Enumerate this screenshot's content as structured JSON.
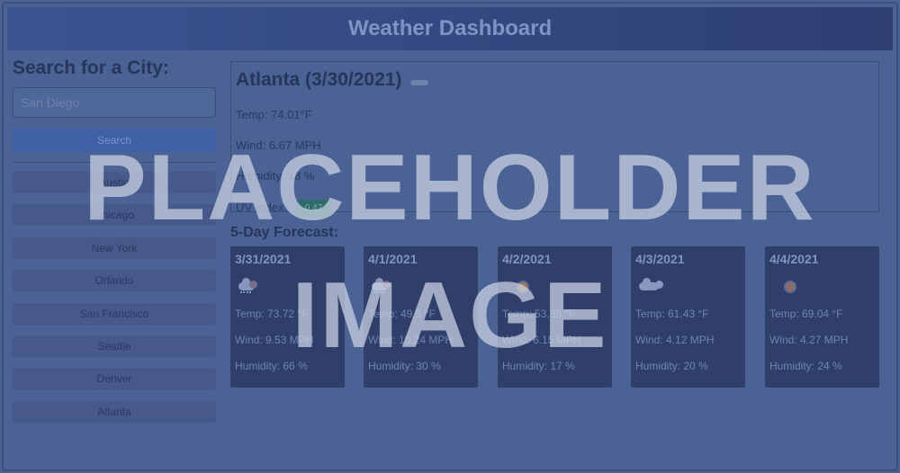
{
  "header": {
    "title": "Weather Dashboard"
  },
  "sidebar": {
    "heading": "Search for a City:",
    "search_value": "San Diego",
    "search_button": "Search",
    "cities": [
      "Austin",
      "Chicago",
      "New York",
      "Orlando",
      "San Francisco",
      "Seattle",
      "Denver",
      "Atlanta"
    ]
  },
  "current": {
    "title": "Atlanta (3/30/2021)",
    "temp": "Temp: 74.01°F",
    "wind": "Wind: 6.67 MPH",
    "humidity": "Humidity: 18 %",
    "uv_label": "UV Index:",
    "uv_value": "0.47",
    "icon": "cloud-icon"
  },
  "forecast": {
    "title": "5-Day Forecast:",
    "days": [
      {
        "date": "3/31/2021",
        "icon": "cloud-rain-icon",
        "temp": "Temp: 73.72 °F",
        "wind": "Wind: 9.53 MPH",
        "humidity": "Humidity: 66 %"
      },
      {
        "date": "4/1/2021",
        "icon": "cloud-rain-icon",
        "temp": "Temp: 49.5 °F",
        "wind": "Wind: 10.24 MPH",
        "humidity": "Humidity: 30 %"
      },
      {
        "date": "4/2/2021",
        "icon": "sun-icon",
        "temp": "Temp: 53.38 °F",
        "wind": "Wind: 6.15 MPH",
        "humidity": "Humidity: 17 %"
      },
      {
        "date": "4/3/2021",
        "icon": "cloud-sun-icon",
        "temp": "Temp: 61.43 °F",
        "wind": "Wind: 4.12 MPH",
        "humidity": "Humidity: 20 %"
      },
      {
        "date": "4/4/2021",
        "icon": "sun-icon",
        "temp": "Temp: 69.04 °F",
        "wind": "Wind: 4.27 MPH",
        "humidity": "Humidity: 24 %"
      }
    ]
  },
  "watermark": {
    "line1": "PLACEHOLDER",
    "line2": "IMAGE"
  },
  "colors": {
    "header_bg": "#2e3f72",
    "card_bg": "#2f3f6a",
    "uv_badge": "#2f6b6e",
    "page_bg": "#4b6394"
  }
}
